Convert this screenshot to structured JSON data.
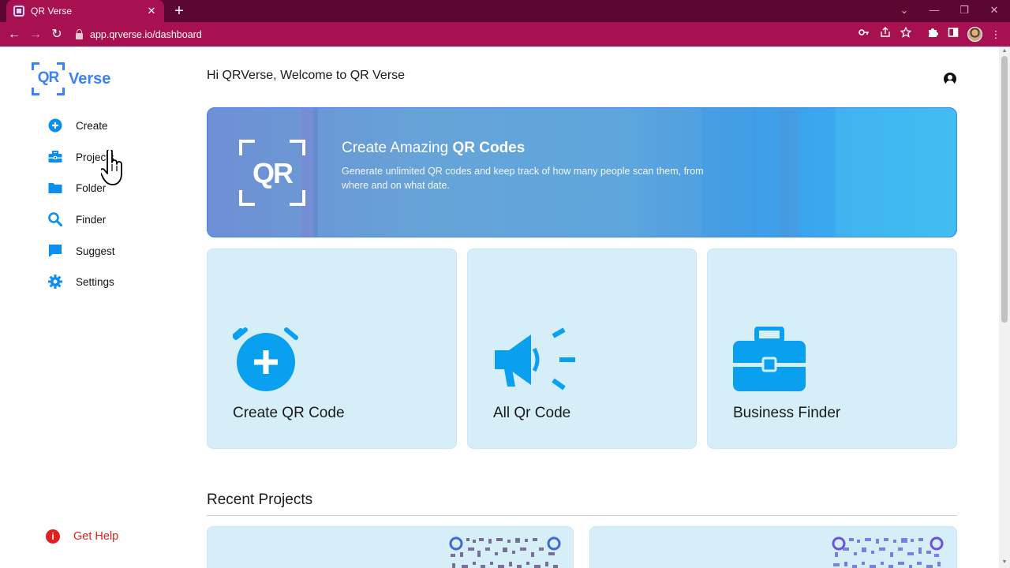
{
  "browser": {
    "tab_title": "QR Verse",
    "tab_close": "✕",
    "new_tab": "+",
    "url": "app.qrverse.io/dashboard",
    "back": "←",
    "forward": "→",
    "reload": "↻",
    "win_minimize": "—",
    "win_restore": "❐",
    "win_close": "✕",
    "win_dropdown": "⌄",
    "menu": "⋮"
  },
  "brand": {
    "logo_qr": "QR",
    "logo_word": "Verse",
    "accent": "#3b82f6"
  },
  "sidebar": {
    "items": [
      {
        "label": "Create",
        "icon": "plus-circle-icon"
      },
      {
        "label": "Projects",
        "icon": "briefcase-icon"
      },
      {
        "label": "Folder",
        "icon": "folder-icon"
      },
      {
        "label": "Finder",
        "icon": "search-icon"
      },
      {
        "label": "Suggest",
        "icon": "chat-bubble-icon"
      },
      {
        "label": "Settings",
        "icon": "gear-icon"
      }
    ],
    "help": {
      "label": "Get Help",
      "icon_glyph": "i",
      "color": "#e02020"
    }
  },
  "header": {
    "welcome": "Hi QRVerse, Welcome to QR Verse"
  },
  "hero": {
    "logo_text": "QR",
    "title_prefix": "Create Amazing ",
    "title_bold": "QR Codes",
    "description": "Generate unlimited QR codes and keep track of how many people scan them, from where and on what date."
  },
  "cards": [
    {
      "label": "Create QR Code",
      "icon": "alarm-plus-icon"
    },
    {
      "label": "All Qr Code",
      "icon": "megaphone-icon"
    },
    {
      "label": "Business Finder",
      "icon": "briefcase-icon"
    }
  ],
  "recent": {
    "title": "Recent Projects"
  },
  "colors": {
    "card_bg": "#d6eef7",
    "icon_blue": "#0aa0f0",
    "chrome": "#a8114f"
  }
}
